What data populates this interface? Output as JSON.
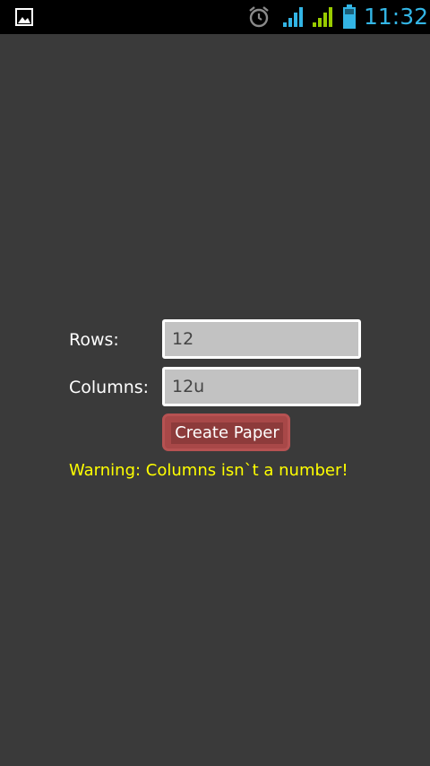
{
  "status_bar": {
    "time": "11:32",
    "icons": [
      "gallery-icon",
      "alarm-icon",
      "signal-icon",
      "signal-icon",
      "battery-icon"
    ],
    "colors": {
      "time": "#33b5e5",
      "signal_blue": "#33b5e5",
      "signal_green": "#99cc00"
    }
  },
  "form": {
    "rows_label": "Rows:",
    "rows_value": "12",
    "columns_label": "Columns:",
    "columns_value": "12u",
    "create_button_label": "Create Paper",
    "warning": "Warning: Columns isn`t a number!"
  },
  "colors": {
    "background": "#3a3a3a",
    "warning": "#ffff00",
    "button": "#a84848",
    "field_background": "#c2c2c2"
  }
}
